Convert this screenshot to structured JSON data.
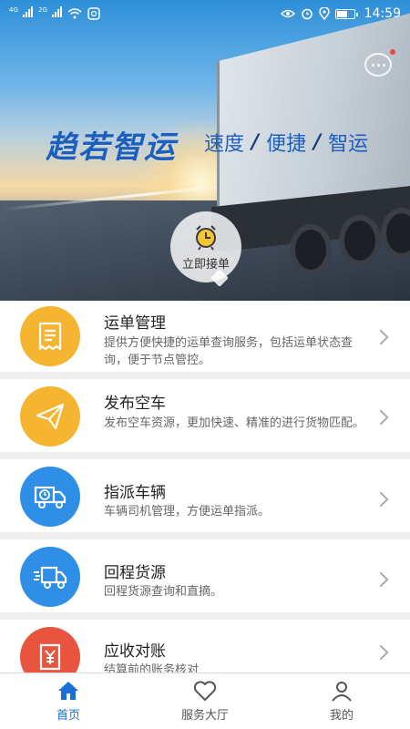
{
  "status_bar": {
    "sim1_label": "4G",
    "sim2_label": "2G",
    "battery_level": 0.65,
    "time": "14:59",
    "icons": [
      "signal-icon",
      "signal-icon",
      "wifi-icon",
      "app-notification-icon",
      "eye-icon",
      "alarm-icon",
      "location-icon",
      "battery-icon"
    ]
  },
  "hero": {
    "brand": "趋若智运",
    "slogan": [
      "速度",
      "便捷",
      "智运"
    ],
    "receive_label": "立即接单",
    "icons": {
      "chat": "chat-bubble-icon",
      "receive": "alarm-clock-icon"
    }
  },
  "menu": [
    {
      "title": "运单管理",
      "desc": "提供方便快捷的运单查询服务，包括运单状态查询，便于节点管控。",
      "icon": "waybill-icon",
      "color": "#f6b531"
    },
    {
      "title": "发布空车",
      "desc": "发布空车资源，更加快速、精准的进行货物匹配。",
      "icon": "paper-plane-icon",
      "color": "#f6b531"
    },
    {
      "title": "指派车辆",
      "desc": "车辆司机管理，方便运单指派。",
      "icon": "truck-clock-icon",
      "color": "#2f8fe6"
    },
    {
      "title": "回程货源",
      "desc": "回程货源查询和直摘。",
      "icon": "truck-fast-icon",
      "color": "#2f8fe6"
    },
    {
      "title": "应收对账",
      "desc": "结算前的账务核对",
      "icon": "yuan-receipt-icon",
      "color": "#e8543e"
    }
  ],
  "tabbar": {
    "tabs": [
      {
        "label": "首页",
        "icon": "home-icon",
        "active": true
      },
      {
        "label": "服务大厅",
        "icon": "heart-icon",
        "active": false
      },
      {
        "label": "我的",
        "icon": "user-icon",
        "active": false
      }
    ],
    "accent": "#1a6fd8"
  }
}
